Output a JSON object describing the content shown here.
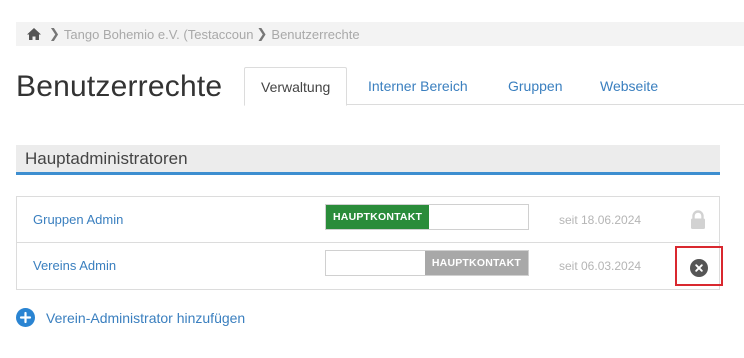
{
  "breadcrumb": {
    "home_icon": "home-icon",
    "items": [
      "Tango Bohemio e.V. (Testaccoun",
      "Benutzerrechte"
    ]
  },
  "page": {
    "title": "Benutzerrechte"
  },
  "tabs": [
    {
      "label": "Verwaltung",
      "active": true
    },
    {
      "label": "Interner Bereich",
      "active": false
    },
    {
      "label": "Gruppen",
      "active": false
    },
    {
      "label": "Webseite",
      "active": false
    }
  ],
  "section": {
    "title": "Hauptadministratoren"
  },
  "admins": [
    {
      "name": "Gruppen Admin",
      "badge": "HAUPTKONTAKT",
      "is_main_contact": true,
      "since": "seit 18.06.2024",
      "action_icon": "lock-icon"
    },
    {
      "name": "Vereins Admin",
      "badge": "HAUPTKONTAKT",
      "is_main_contact": false,
      "since": "seit 06.03.2024",
      "action_icon": "remove-icon"
    }
  ],
  "add_admin": {
    "label": "Verein-Administrator hinzufügen",
    "icon": "plus-circle-icon"
  },
  "colors": {
    "link": "#3a7fbf",
    "accent": "#3d8ed0",
    "badge_on": "#2a8c3a",
    "badge_off": "#a8a8a8",
    "highlight": "#d9282f"
  }
}
